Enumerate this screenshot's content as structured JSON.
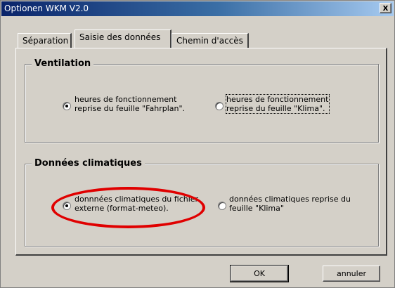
{
  "window": {
    "title": "Optionen WKM V2.0",
    "close_label": "x"
  },
  "tabs": [
    {
      "label": "Séparation",
      "active": false
    },
    {
      "label": "Saisie des données",
      "active": true
    },
    {
      "label": "Chemin d'accès",
      "active": false
    }
  ],
  "ventilation": {
    "title": "Ventilation",
    "options": [
      {
        "label_line1": "heures de fonctionnement",
        "label_line2": "reprise du feuille \"Fahrplan\".",
        "selected": true
      },
      {
        "label_line1": "heures de fonctionnement",
        "label_line2": "reprise du feuille \"Klima\".",
        "selected": false
      }
    ]
  },
  "climate": {
    "title": "Données climatiques",
    "options": [
      {
        "label_line1": "donnnées climatiques du fichier",
        "label_line2": "externe (format-meteo).",
        "selected": true
      },
      {
        "label_line1": "données climatiques reprise du",
        "label_line2": "feuille \"Klima\"",
        "selected": false
      }
    ]
  },
  "buttons": {
    "ok": "OK",
    "cancel": "annuler"
  },
  "colors": {
    "dialog_background": "#d4d0c8",
    "titlebar_start": "#0a246a",
    "titlebar_end": "#a6caf0",
    "annotation": "#e00000"
  }
}
